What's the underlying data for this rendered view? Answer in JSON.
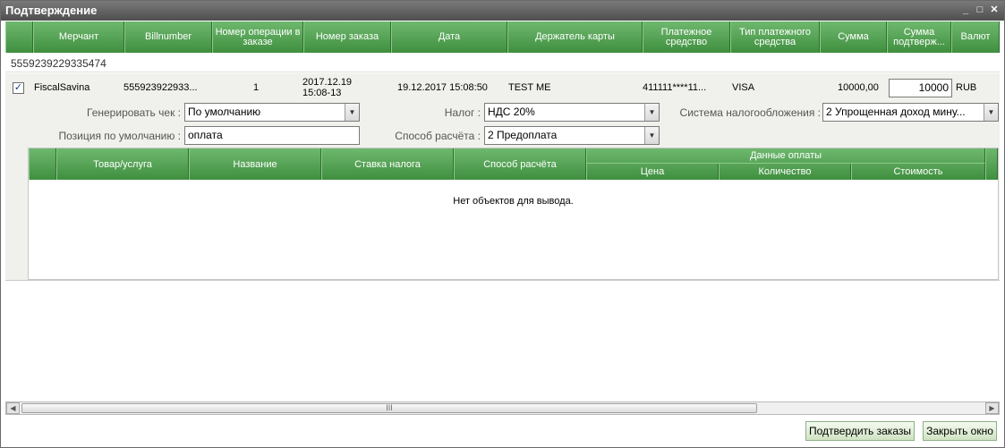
{
  "window": {
    "title": "Подтверждение",
    "minimize_glyph": "_",
    "maximize_glyph": "□",
    "close_glyph": "✕"
  },
  "columns": [
    "",
    "Мерчант",
    "Billnumber",
    "Номер операции в заказе",
    "Номер заказа",
    "Дата",
    "Держатель карты",
    "Платежное средство",
    "Тип платежного средства",
    "Сумма",
    "Сумма подтверж...",
    "Валют"
  ],
  "group": {
    "label": "5559239229335474"
  },
  "row": {
    "checked": true,
    "check_glyph": "✓",
    "merchant": "FiscalSavina",
    "billnumber": "555923922933...",
    "op_number": "1",
    "order_number": "2017.12.19 15:08-13",
    "date": "19.12.2017 15:08:50",
    "holder": "TEST ME",
    "card": "411111****11...",
    "card_type": "VISA",
    "amount": "10000,00",
    "confirm_amount": "10000",
    "currency": "RUB"
  },
  "form": {
    "receipt_label": "Генерировать чек :",
    "receipt_value": "По умолчанию",
    "tax_label": "Налог :",
    "tax_value": "НДС 20%",
    "tax_system_label": "Система налогообложения :",
    "tax_system_value": "2 Упрощенная доход мину...",
    "default_pos_label": "Позиция по умолчанию :",
    "default_pos_value": "оплата",
    "pay_method_label": "Способ расчёта :",
    "pay_method_value": "2 Предоплата"
  },
  "sub_table": {
    "columns": [
      "Товар/услуга",
      "Название",
      "Ставка налога",
      "Способ расчёта"
    ],
    "group_header": "Данные оплаты",
    "group_columns": [
      "Цена",
      "Количество",
      "Стоимость"
    ],
    "empty_text": "Нет объектов для вывода."
  },
  "scrollbar": {
    "left_glyph": "◀",
    "right_glyph": "▶",
    "grip": "III"
  },
  "buttons": {
    "confirm": "Подтвердить заказы",
    "close": "Закрыть окно"
  },
  "colors": {
    "header_green": "#4e9f4e",
    "titlebar": "#5e5e5e"
  }
}
